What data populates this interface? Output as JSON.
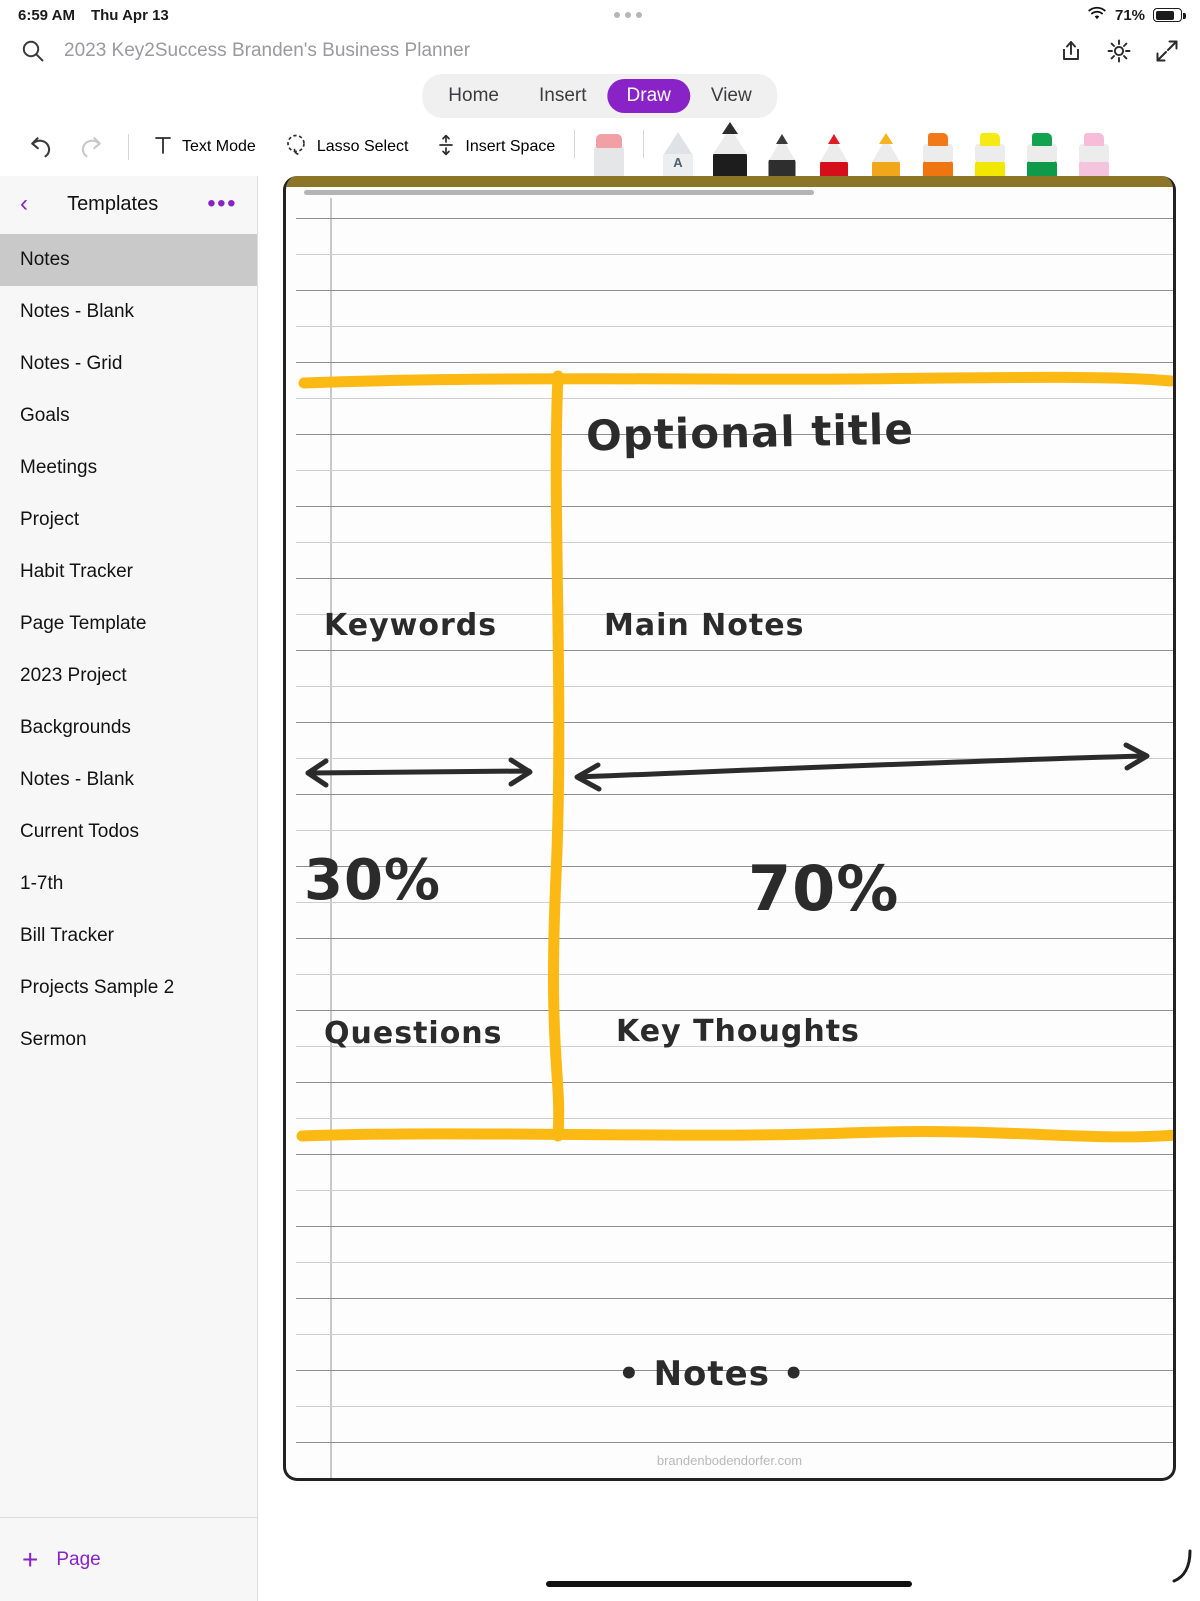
{
  "status_bar": {
    "time": "6:59 AM",
    "date": "Thu Apr 13",
    "battery_percent": "71%",
    "wifi_icon": "wifi-icon",
    "battery_icon": "battery-icon",
    "multitask_icon": "multitask-dots-icon"
  },
  "title_bar": {
    "search_icon": "search-icon",
    "document_title": "2023 Key2Success Branden's Business Planner",
    "share_icon": "share-icon",
    "settings_icon": "gear-icon",
    "expand_icon": "expand-arrows-icon"
  },
  "tabs": {
    "items": [
      {
        "label": "Home",
        "active": false
      },
      {
        "label": "Insert",
        "active": false
      },
      {
        "label": "Draw",
        "active": true
      },
      {
        "label": "View",
        "active": false
      }
    ],
    "active_color": "#8a23c7"
  },
  "draw_toolbar": {
    "undo_icon": "undo-icon",
    "redo_icon": "redo-icon",
    "text_mode_label": "Text Mode",
    "text_mode_icon": "text-t-icon",
    "lasso_label": "Lasso Select",
    "lasso_icon": "lasso-icon",
    "insert_space_label": "Insert Space",
    "insert_space_icon": "insert-space-icon",
    "tools": [
      {
        "name": "eraser-tool",
        "tip": "#f2a0a6",
        "body": "#e4e6e8",
        "selected": false
      },
      {
        "name": "text-pen-tool",
        "tip": "#c9d2da",
        "body": "#eceef0",
        "selected": false
      },
      {
        "name": "black-marker-tool",
        "tip": "#2c2c2c",
        "body": "#1d1d1d",
        "selected": true
      },
      {
        "name": "black-thin-pen-tool",
        "tip": "#3a3a3a",
        "body": "#2e2e2e",
        "selected": false
      },
      {
        "name": "red-pen-tool",
        "tip": "#e01b24",
        "body": "#d50f1a",
        "selected": false
      },
      {
        "name": "yellow-pen-tool",
        "tip": "#f5b321",
        "body": "#f0a81a",
        "selected": false
      },
      {
        "name": "orange-highlighter-tool",
        "tip": "#f2791a",
        "body": "#ef7510",
        "selected": false
      },
      {
        "name": "yellow-highlighter-tool",
        "tip": "#f5ea13",
        "body": "#f2e700",
        "selected": false
      },
      {
        "name": "green-highlighter-tool",
        "tip": "#12a350",
        "body": "#0f9a4a",
        "selected": false
      },
      {
        "name": "pink-highlighter-tool",
        "tip": "#f6bcd8",
        "body": "#f4c3dc",
        "selected": false
      }
    ]
  },
  "sidebar": {
    "back_icon": "chevron-left-icon",
    "title": "Templates",
    "more_icon": "ellipsis-icon",
    "items": [
      {
        "label": "Notes",
        "selected": true
      },
      {
        "label": "Notes - Blank",
        "selected": false
      },
      {
        "label": "Notes - Grid",
        "selected": false
      },
      {
        "label": "Goals",
        "selected": false
      },
      {
        "label": "Meetings",
        "selected": false
      },
      {
        "label": "Project",
        "selected": false
      },
      {
        "label": "Habit Tracker",
        "selected": false
      },
      {
        "label": "Page Template",
        "selected": false
      },
      {
        "label": "2023 Project",
        "selected": false
      },
      {
        "label": "Backgrounds",
        "selected": false
      },
      {
        "label": "Notes - Blank",
        "selected": false
      },
      {
        "label": "Current Todos",
        "selected": false
      },
      {
        "label": "1-7th",
        "selected": false
      },
      {
        "label": "Bill Tracker",
        "selected": false
      },
      {
        "label": "Projects Sample 2",
        "selected": false
      },
      {
        "label": "Sermon",
        "selected": false
      }
    ],
    "add_page_icon": "plus-icon",
    "add_page_label": "Page"
  },
  "page": {
    "header_band_color": "#8c7526",
    "highlight_color": "#fcb913",
    "ink_color": "#2b2b2b",
    "watermark": "brandenbodendorfer.com",
    "handwriting": {
      "title": "Optional title",
      "keywords": "Keywords",
      "main_notes": "Main Notes",
      "left_percent": "30%",
      "right_percent": "70%",
      "questions": "Questions",
      "key_thoughts": "Key Thoughts",
      "notes": "• Notes •"
    }
  }
}
